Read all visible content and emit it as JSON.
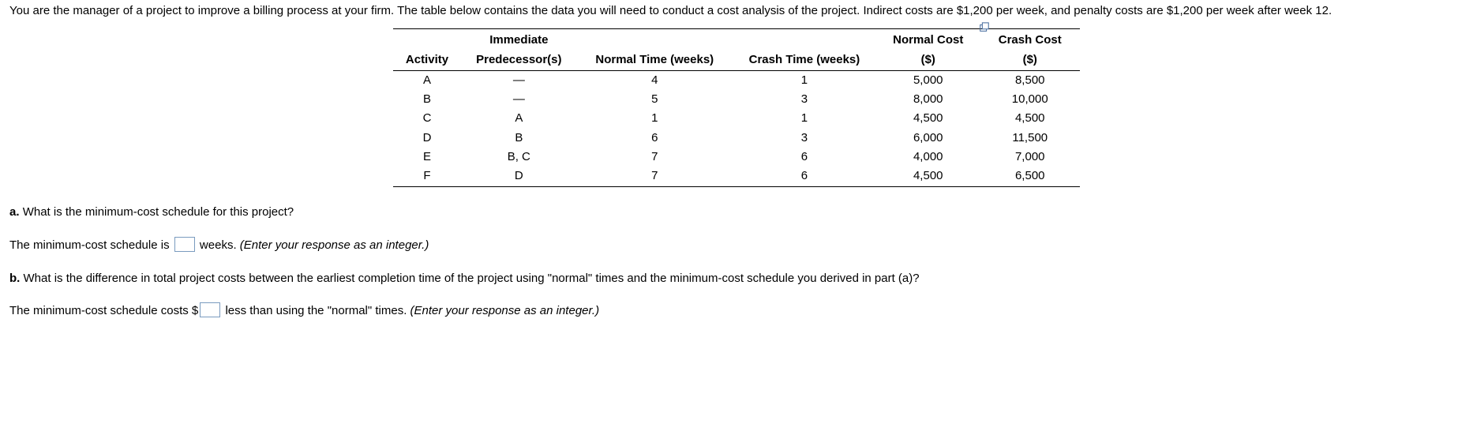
{
  "intro": "You are the manager of a project to improve a billing process at your firm. The table below contains the data you will need to conduct a cost analysis of the project. Indirect costs are $1,200 per week, and penalty costs are $1,200 per week after week 12.",
  "table": {
    "headers": {
      "activity": "Activity",
      "pred_top": "Immediate",
      "pred_bot": "Predecessor(s)",
      "normal_time": "Normal Time (weeks)",
      "crash_time": "Crash Time (weeks)",
      "nc_top": "Normal Cost",
      "nc_bot": "($)",
      "cc_top": "Crash Cost",
      "cc_bot": "($)"
    },
    "rows": [
      {
        "activity": "A",
        "pred": "—",
        "nt": "4",
        "ct": "1",
        "nc": "5,000",
        "cc": "8,500"
      },
      {
        "activity": "B",
        "pred": "—",
        "nt": "5",
        "ct": "3",
        "nc": "8,000",
        "cc": "10,000"
      },
      {
        "activity": "C",
        "pred": "A",
        "nt": "1",
        "ct": "1",
        "nc": "4,500",
        "cc": "4,500"
      },
      {
        "activity": "D",
        "pred": "B",
        "nt": "6",
        "ct": "3",
        "nc": "6,000",
        "cc": "11,500"
      },
      {
        "activity": "E",
        "pred": "B, C",
        "nt": "7",
        "ct": "6",
        "nc": "4,000",
        "cc": "7,000"
      },
      {
        "activity": "F",
        "pred": "D",
        "nt": "7",
        "ct": "6",
        "nc": "4,500",
        "cc": "6,500"
      }
    ]
  },
  "qa": {
    "a_label": "a.",
    "a_text": "What is the minimum-cost schedule for this project?",
    "a_ans_pre": "The minimum-cost schedule is",
    "a_ans_post": "weeks.",
    "a_hint": "(Enter your response as an integer.)",
    "b_label": "b.",
    "b_text": "What is the difference in total project costs between the earliest completion time of the project using \"normal\" times and the minimum-cost schedule you derived in part (a)?",
    "b_ans_pre": "The minimum-cost schedule costs $",
    "b_ans_post": "less than using the \"normal\" times.",
    "b_hint": "(Enter your response as an integer.)"
  }
}
